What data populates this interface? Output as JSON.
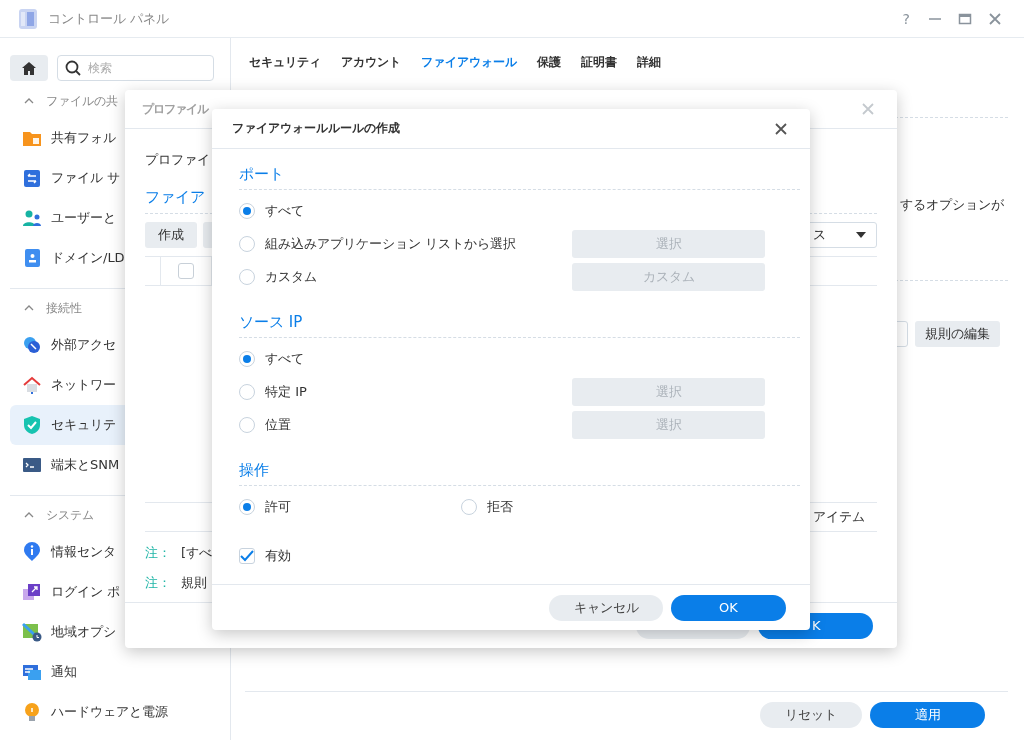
{
  "window": {
    "title": "コントロール パネル",
    "help_button": "?"
  },
  "sidebar": {
    "search_placeholder": "検索",
    "groups": [
      {
        "label": "ファイルの共",
        "items": [
          {
            "label": "共有フォル",
            "selected": false
          },
          {
            "label": "ファイル サ",
            "selected": false
          },
          {
            "label": "ユーザーと",
            "selected": false
          },
          {
            "label": "ドメイン/LD",
            "selected": false
          }
        ]
      },
      {
        "label": "接続性",
        "items": [
          {
            "label": "外部アクセ",
            "selected": false
          },
          {
            "label": "ネットワー",
            "selected": false
          },
          {
            "label": "セキュリテ",
            "selected": true
          },
          {
            "label": "端末とSNM",
            "selected": false
          }
        ]
      },
      {
        "label": "システム",
        "items": [
          {
            "label": "情報センタ",
            "selected": false
          },
          {
            "label": "ログイン ポ",
            "selected": false
          },
          {
            "label": "地域オプシ",
            "selected": false
          },
          {
            "label": "通知",
            "selected": false
          },
          {
            "label": "ハードウェアと電源",
            "selected": false
          }
        ]
      }
    ]
  },
  "tabs": [
    {
      "label": "セキュリティ",
      "selected": false
    },
    {
      "label": "アカウント",
      "selected": false
    },
    {
      "label": "ファイアウォール",
      "selected": true
    },
    {
      "label": "保護",
      "selected": false
    },
    {
      "label": "証明書",
      "selected": false
    },
    {
      "label": "詳細",
      "selected": false
    }
  ],
  "main": {
    "option_text": "するオプションが",
    "edit_rules_button": "規則の編集",
    "reset_button": "リセット",
    "apply_button": "適用"
  },
  "profile_dialog": {
    "title": "プロファイル",
    "profile_label": "プロファイ",
    "section_title": "ファイア",
    "create_button": "作成",
    "dropdown_value": "ス",
    "select_all_checked": false,
    "item_count": "アイテム",
    "notes": [
      {
        "label": "注：",
        "text": "[すべ"
      },
      {
        "label": "注：",
        "text": "規則"
      }
    ],
    "ok_button": "K"
  },
  "rule_dialog": {
    "title": "ファイアウォールルールの作成",
    "sections": [
      {
        "title": "ポート",
        "kind": "list",
        "options": [
          {
            "label": "すべて",
            "selected": true
          },
          {
            "label": "組み込みアプリケーション リストから選択",
            "selected": false,
            "button": {
              "label": "選択",
              "disabled": true
            }
          },
          {
            "label": "カスタム",
            "selected": false,
            "button": {
              "label": "カスタム",
              "disabled": true
            }
          }
        ]
      },
      {
        "title": "ソース IP",
        "kind": "list",
        "options": [
          {
            "label": "すべて",
            "selected": true
          },
          {
            "label": "特定 IP",
            "selected": false,
            "button": {
              "label": "選択",
              "disabled": true
            }
          },
          {
            "label": "位置",
            "selected": false,
            "button": {
              "label": "選択",
              "disabled": true
            }
          }
        ]
      },
      {
        "title": "操作",
        "kind": "inline",
        "options": [
          {
            "label": "許可",
            "selected": true
          },
          {
            "label": "拒否",
            "selected": false
          }
        ]
      }
    ],
    "enabled": {
      "label": "有効",
      "checked": true
    },
    "cancel_button": "キャンセル",
    "ok_button": "OK"
  }
}
